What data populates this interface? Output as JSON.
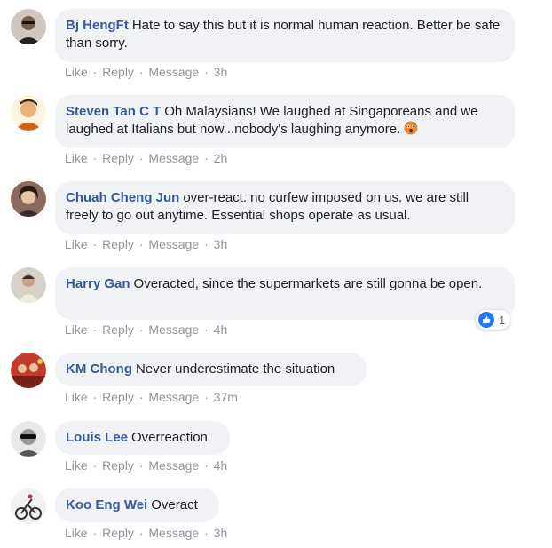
{
  "action_labels": {
    "like": "Like",
    "reply": "Reply",
    "message": "Message",
    "sep": "·"
  },
  "comments": [
    {
      "author": "Bj HengFt",
      "text": "Hate to say this but it is normal human reaction. Better be safe than sorry.",
      "time": "3h"
    },
    {
      "author": "Steven Tan C T",
      "text": "Oh Malaysians! We laughed at Singaporeans and we laughed at Italians but now...nobody's laughing anymore.",
      "time": "2h",
      "emoji": "scared-face-emoji"
    },
    {
      "author": "Chuah Cheng Jun",
      "text": "over-react. no curfew imposed on us. we are still freely to go out anytime. Essential shops operate as usual.",
      "time": "3h"
    },
    {
      "author": "Harry Gan",
      "text": "Overacted, since the supermarkets are still gonna be open.",
      "time": "4h",
      "reaction": {
        "type": "like",
        "count": "1"
      }
    },
    {
      "author": "KM Chong",
      "text": "Never underestimate the situation",
      "time": "37m"
    },
    {
      "author": "Louis Lee",
      "text": "Overreaction",
      "time": "4h"
    },
    {
      "author": "Koo Eng Wei",
      "text": "Overact",
      "time": "3h"
    }
  ],
  "colors": {
    "author": "#385898",
    "bubble": "#f0f2f5",
    "action": "#90949c",
    "like_blue": "#2078f4"
  }
}
